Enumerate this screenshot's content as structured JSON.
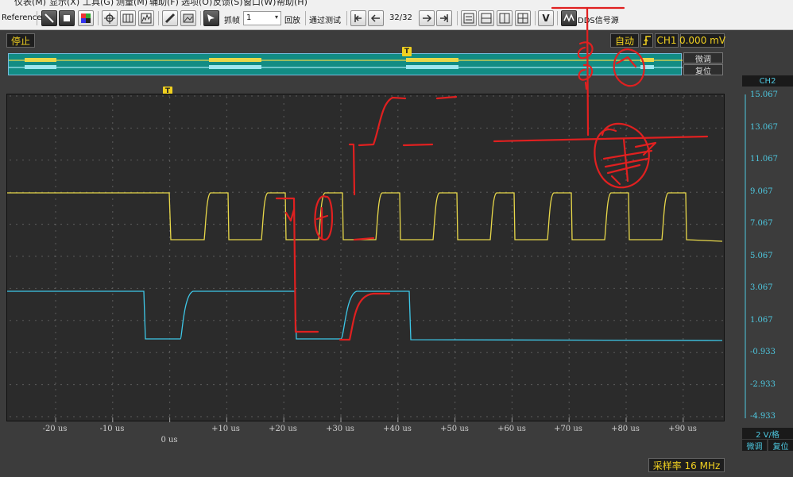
{
  "menu": [
    "仪表(M)",
    "显示(X)",
    "工具(G)",
    "测量(M)",
    "辅助(F)",
    "选项(O)",
    "反馈(S)",
    "窗口(W)",
    "帮助(H)"
  ],
  "toolbar": {
    "reference": "Reference",
    "capture_label": "抓帧",
    "capture_value": "1",
    "playback": "回放",
    "pass_test": "通过测试",
    "frame_counter": "32/32",
    "dds": "DDS信号源"
  },
  "status": {
    "state": "停止",
    "trigger_mode": "自动",
    "trigger_channel": "CH1",
    "trigger_level": "0.000 mV"
  },
  "overview": {
    "fine_adjust": "微调",
    "reset": "复位"
  },
  "trigger_marker": "T",
  "x_axis": [
    "-20 us",
    "-10 us",
    "0 us",
    "+10 us",
    "+20 us",
    "+30 us",
    "+40 us",
    "+50 us",
    "+60 us",
    "+70 us",
    "+80 us",
    "+90 us"
  ],
  "scale": {
    "channel": "CH2",
    "labels": [
      "15.067",
      "13.067",
      "11.067",
      "9.067",
      "7.067",
      "5.067",
      "3.067",
      "1.067",
      "-0.933",
      "-2.933",
      "-4.933"
    ],
    "volts_per_div": "2 V/格",
    "fine_adjust": "微调",
    "reset": "复位"
  },
  "sample_rate": "采样率 16 MHz",
  "colors": {
    "ch1": "#e8d84a",
    "ch2": "#3ec8e8",
    "annotation": "#e02020",
    "status_text": "#f0d020"
  }
}
